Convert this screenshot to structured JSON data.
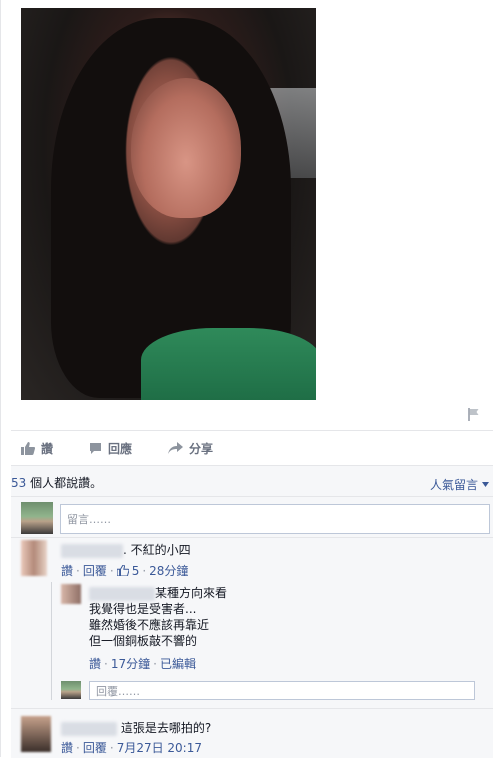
{
  "post": {
    "actions": {
      "like": "讚",
      "comment": "回應",
      "share": "分享"
    }
  },
  "likes": {
    "count": "53",
    "suffix": " 個人都說讚。"
  },
  "sort_label": "人氣留言",
  "composer": {
    "placeholder": "留言……"
  },
  "comments": [
    {
      "text": ". 不紅的小四",
      "meta": {
        "like": "讚",
        "reply": "回覆",
        "sep": "·",
        "likes": "5",
        "time": "28分鐘"
      },
      "replies": [
        {
          "lines": [
            "某種方向來看",
            "我覺得也是受害者...",
            "雖然婚後不應該再靠近",
            "但一個銅板敲不響的"
          ],
          "meta": {
            "like": "讚",
            "sep": "·",
            "time": "17分鐘",
            "edited": "已編輯"
          }
        }
      ],
      "reply_composer": {
        "placeholder": "回覆……"
      }
    },
    {
      "text": "這張是去哪拍的?",
      "meta": {
        "like": "讚",
        "reply": "回覆",
        "sep": "·",
        "time": "7月27日 20:17"
      }
    }
  ]
}
